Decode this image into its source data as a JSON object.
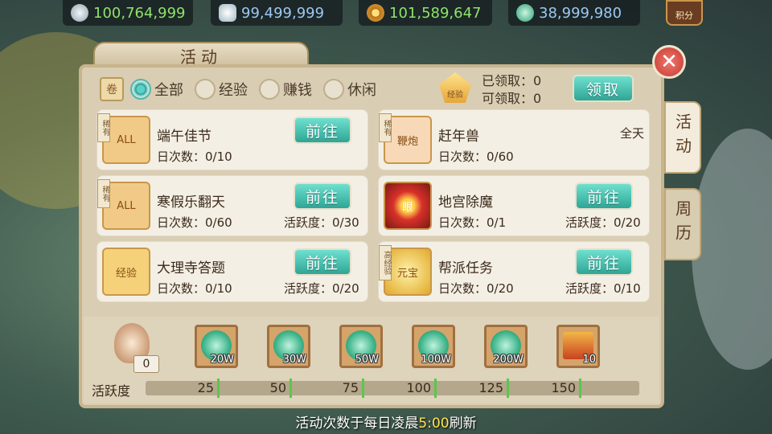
{
  "currencies": [
    {
      "value": "100,764,999",
      "icon": "silver-ingot-icon"
    },
    {
      "value": "99,499,999",
      "icon": "silver-ingot-icon"
    },
    {
      "value": "101,589,647",
      "icon": "copper-coin-icon"
    },
    {
      "value": "38,999,980",
      "icon": "jade-icon"
    }
  ],
  "jifen_label": "积分",
  "panel_title": "活动",
  "filters": [
    {
      "label": "全部",
      "selected": true
    },
    {
      "label": "经验",
      "selected": false
    },
    {
      "label": "赚钱",
      "selected": false
    },
    {
      "label": "休闲",
      "selected": false
    }
  ],
  "claim": {
    "claimed": "已领取：0",
    "claimable": "可领取：0",
    "button": "领取",
    "icon_label": "经验"
  },
  "activities": [
    {
      "tag": "稀有",
      "icon_label": "ALL",
      "name": "端午佳节",
      "count": "日次数：0/10",
      "activity": "",
      "button": "前往"
    },
    {
      "tag": "稀有",
      "icon_label": "鞭炮",
      "name": "赶年兽",
      "count": "日次数：0/60",
      "activity": "",
      "time": "全天"
    },
    {
      "tag": "稀有",
      "icon_label": "ALL",
      "name": "寒假乐翻天",
      "count": "日次数：0/60",
      "activity": "活跃度：0/30",
      "button": "前往"
    },
    {
      "tag": "",
      "icon_label": "眼",
      "name": "地宫除魔",
      "count": "日次数：0/1",
      "activity": "活跃度：0/20",
      "button": "前往"
    },
    {
      "tag": "",
      "icon_label": "经验",
      "name": "大理寺答题",
      "count": "日次数：0/10",
      "activity": "活跃度：0/20",
      "button": "前往"
    },
    {
      "tag": "高经验",
      "icon_label": "元宝",
      "name": "帮派任务",
      "count": "日次数：0/20",
      "activity": "活跃度：0/10",
      "button": "前往"
    }
  ],
  "side_tabs": [
    {
      "label": "活动",
      "active": true
    },
    {
      "label": "周历",
      "active": false
    }
  ],
  "mascot_score": "0",
  "rewards": [
    {
      "amount": "20W",
      "type": "jade"
    },
    {
      "amount": "30W",
      "type": "jade"
    },
    {
      "amount": "50W",
      "type": "jade"
    },
    {
      "amount": "100W",
      "type": "jade"
    },
    {
      "amount": "200W",
      "type": "jade"
    },
    {
      "amount": "10",
      "type": "chest"
    }
  ],
  "activity_bar": {
    "label": "活跃度",
    "progress_fraction": 0,
    "milestones": [
      "25",
      "50",
      "75",
      "100",
      "125",
      "150"
    ]
  },
  "footer": {
    "prefix": "活动次数于每日凌晨",
    "time": "5:00",
    "suffix": "刷新"
  }
}
